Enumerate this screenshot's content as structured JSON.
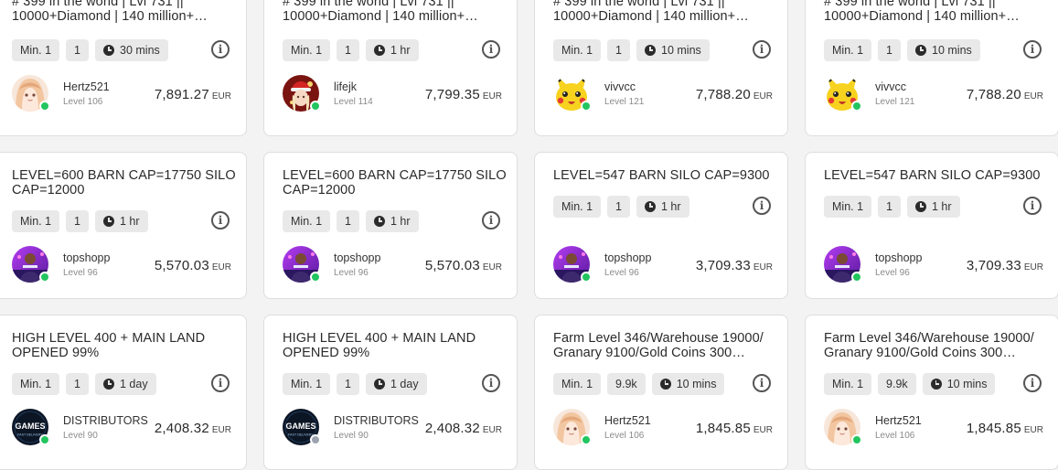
{
  "colors": {
    "online": "#22c55e",
    "offline": "#9ca3af"
  },
  "offers": [
    {
      "title": "# 399 in the world | Lvl 731 || 10000+Diamond | 140 million+ ducats...",
      "min_label": "Min. 1",
      "qty": "1",
      "delivery": "30 mins",
      "seller": "Hertz521",
      "level": "Level 106",
      "price": "7,891.27",
      "currency": "EUR",
      "avatar": "anime-girl-avatar",
      "online": true
    },
    {
      "title": "# 399 in the world | Lvl 731 || 10000+Diamond | 140 million+ ducats...",
      "min_label": "Min. 1",
      "qty": "1",
      "delivery": "1 hr",
      "seller": "lifejk",
      "level": "Level 114",
      "price": "7,799.35",
      "currency": "EUR",
      "avatar": "santa-girl-avatar",
      "online": true
    },
    {
      "title": "# 399 in the world | Lvl 731 || 10000+Diamond | 140 million+ ducats...",
      "min_label": "Min. 1",
      "qty": "1",
      "delivery": "10 mins",
      "seller": "vivvcc",
      "level": "Level 121",
      "price": "7,788.20",
      "currency": "EUR",
      "avatar": "pikachu-avatar",
      "online": true
    },
    {
      "title": "# 399 in the world | Lvl 731 || 10000+Diamond | 140 million+ ducats...",
      "min_label": "Min. 1",
      "qty": "1",
      "delivery": "10 mins",
      "seller": "vivvcc",
      "level": "Level 121",
      "price": "7,788.20",
      "currency": "EUR",
      "avatar": "pikachu-avatar",
      "online": true
    },
    {
      "title": "LEVEL=600 BARN CAP=17750 SILO CAP=12000",
      "min_label": "Min. 1",
      "qty": "1",
      "delivery": "1 hr",
      "seller": "topshopp",
      "level": "Level 96",
      "price": "5,570.03",
      "currency": "EUR",
      "avatar": "gamer-avatar",
      "online": true
    },
    {
      "title": "LEVEL=600 BARN CAP=17750 SILO CAP=12000",
      "min_label": "Min. 1",
      "qty": "1",
      "delivery": "1 hr",
      "seller": "topshopp",
      "level": "Level 96",
      "price": "5,570.03",
      "currency": "EUR",
      "avatar": "gamer-avatar",
      "online": true
    },
    {
      "title": "LEVEL=547 BARN SILO CAP=9300",
      "min_label": "Min. 1",
      "qty": "1",
      "delivery": "1 hr",
      "seller": "topshopp",
      "level": "Level 96",
      "price": "3,709.33",
      "currency": "EUR",
      "avatar": "gamer-avatar",
      "online": true
    },
    {
      "title": "LEVEL=547 BARN SILO CAP=9300",
      "min_label": "Min. 1",
      "qty": "1",
      "delivery": "1 hr",
      "seller": "topshopp",
      "level": "Level 96",
      "price": "3,709.33",
      "currency": "EUR",
      "avatar": "gamer-avatar",
      "online": true
    },
    {
      "title": "HIGH LEVEL 400 + MAIN LAND OPENED 99%",
      "min_label": "Min. 1",
      "qty": "1",
      "delivery": "1 day",
      "seller": "DISTRIBUTORS",
      "level": "Level 90",
      "price": "2,408.32",
      "currency": "EUR",
      "avatar": "games-logo-avatar",
      "avatar_text": "GAMES",
      "avatar_subtext": "FAST DELIVERY",
      "online": true
    },
    {
      "title": "HIGH LEVEL 400 + MAIN LAND OPENED 99%",
      "min_label": "Min. 1",
      "qty": "1",
      "delivery": "1 day",
      "seller": "DISTRIBUTORS",
      "level": "Level 90",
      "price": "2,408.32",
      "currency": "EUR",
      "avatar": "games-logo-avatar",
      "avatar_text": "GAMES",
      "avatar_subtext": "FAST DELIVERY",
      "online": false
    },
    {
      "title": "Farm Level 346/Warehouse 19000/ Granary 9100/Gold Coins 300 Million...",
      "min_label": "Min. 1",
      "qty": "9.9k",
      "delivery": "10 mins",
      "seller": "Hertz521",
      "level": "Level 106",
      "price": "1,845.85",
      "currency": "EUR",
      "avatar": "anime-girl-avatar",
      "online": true
    },
    {
      "title": "Farm Level 346/Warehouse 19000/ Granary 9100/Gold Coins 300 Million...",
      "min_label": "Min. 1",
      "qty": "9.9k",
      "delivery": "10 mins",
      "seller": "Hertz521",
      "level": "Level 106",
      "price": "1,845.85",
      "currency": "EUR",
      "avatar": "anime-girl-avatar",
      "online": true
    }
  ]
}
